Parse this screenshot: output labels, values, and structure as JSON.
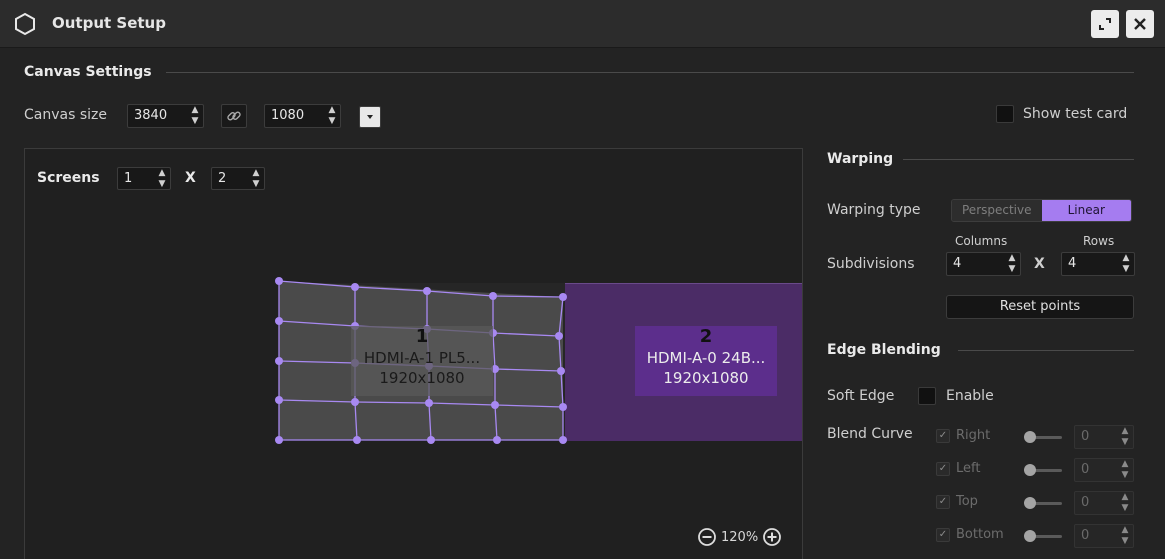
{
  "window": {
    "title": "Output Setup",
    "icon": "hexagon-icon",
    "buttons": [
      "maximize-icon",
      "close-icon"
    ]
  },
  "canvas_settings": {
    "heading": "Canvas Settings",
    "size_label": "Canvas size",
    "width": "3840",
    "height": "1080",
    "link_icon": "link-icon",
    "dropdown_icon": "chevron-down-icon",
    "test_card_label": "Show test card",
    "test_card_checked": false
  },
  "screens": {
    "label": "Screens",
    "rows": "1",
    "separator": "X",
    "cols": "2",
    "items": [
      {
        "number": "1",
        "name": "HDMI-A-1 PL5...",
        "resolution": "1920x1080"
      },
      {
        "number": "2",
        "name": "HDMI-A-0 24B...",
        "resolution": "1920x1080"
      }
    ]
  },
  "zoom": {
    "value": "120%",
    "minus_icon": "zoom-out-icon",
    "plus_icon": "zoom-in-icon"
  },
  "warping": {
    "heading": "Warping",
    "type_label": "Warping type",
    "options": [
      "Perspective",
      "Linear"
    ],
    "selected": "Linear",
    "subdivisions_label": "Subdivisions",
    "columns_label": "Columns",
    "rows_label": "Rows",
    "columns": "4",
    "separator": "X",
    "rows": "4",
    "reset_label": "Reset points"
  },
  "edge_blending": {
    "heading": "Edge Blending",
    "soft_edge_label": "Soft Edge",
    "enable_label": "Enable",
    "enabled": false,
    "blend_curve_label": "Blend Curve",
    "sides": [
      {
        "label": "Right",
        "value": "0",
        "checked": true
      },
      {
        "label": "Left",
        "value": "0",
        "checked": true
      },
      {
        "label": "Top",
        "value": "0",
        "checked": true
      },
      {
        "label": "Bottom",
        "value": "0",
        "checked": true
      }
    ]
  },
  "colors": {
    "accent": "#a57cf0",
    "screen2_fill": "#4b2c66",
    "screen1_fill": "#4a4a4a",
    "warp_grid": "#a889f2"
  }
}
